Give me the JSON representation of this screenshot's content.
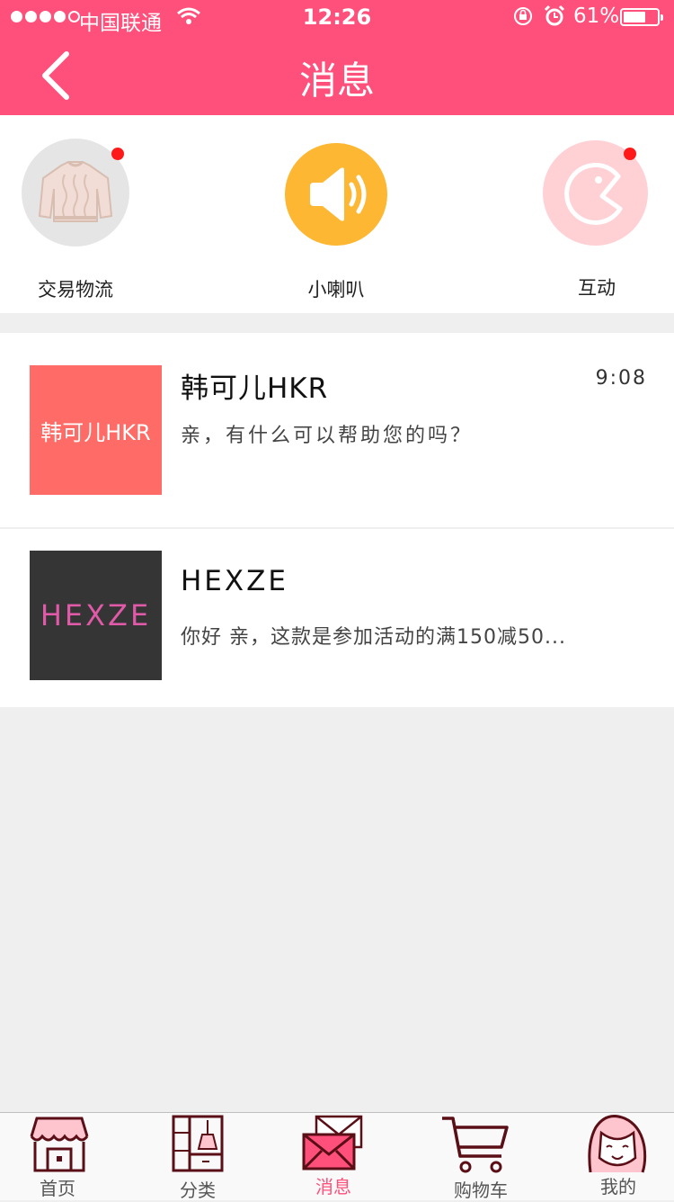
{
  "status": {
    "carrier": "中国联通",
    "time": "12:26",
    "battery": "61%"
  },
  "header": {
    "title": "消息"
  },
  "shortcuts": [
    {
      "label": "交易物流",
      "icon": "sweater-icon",
      "has_badge": true
    },
    {
      "label": "小喇叭",
      "icon": "speaker-icon",
      "has_badge": false
    },
    {
      "label": "互动",
      "icon": "chat-face-icon",
      "has_badge": true
    }
  ],
  "messages": [
    {
      "avatar_text": "韩可儿HKR",
      "avatar_color": "#ff6b66",
      "name": "韩可儿HKR",
      "preview": "亲，有什么可以帮助您的吗？",
      "time": "9:08"
    },
    {
      "avatar_text": "HEXZE",
      "avatar_color": "#353535",
      "avatar_text_color": "#e05aa8",
      "name": "HEXZE",
      "preview": "你好 亲，这款是参加活动的满150减50...",
      "time": ""
    }
  ],
  "tabs": [
    {
      "label": "首页",
      "icon": "store-icon"
    },
    {
      "label": "分类",
      "icon": "cabinet-icon"
    },
    {
      "label": "消息",
      "icon": "envelope-icon",
      "active": true
    },
    {
      "label": "购物车",
      "icon": "cart-icon"
    },
    {
      "label": "我的",
      "icon": "girl-face-icon"
    }
  ],
  "colors": {
    "brand": "#ff4f7b",
    "badge": "#ff1a1a",
    "speaker_bg": "#fdb732",
    "interact_bg": "#ffd1d5",
    "icon_stroke": "#5a0e16"
  }
}
